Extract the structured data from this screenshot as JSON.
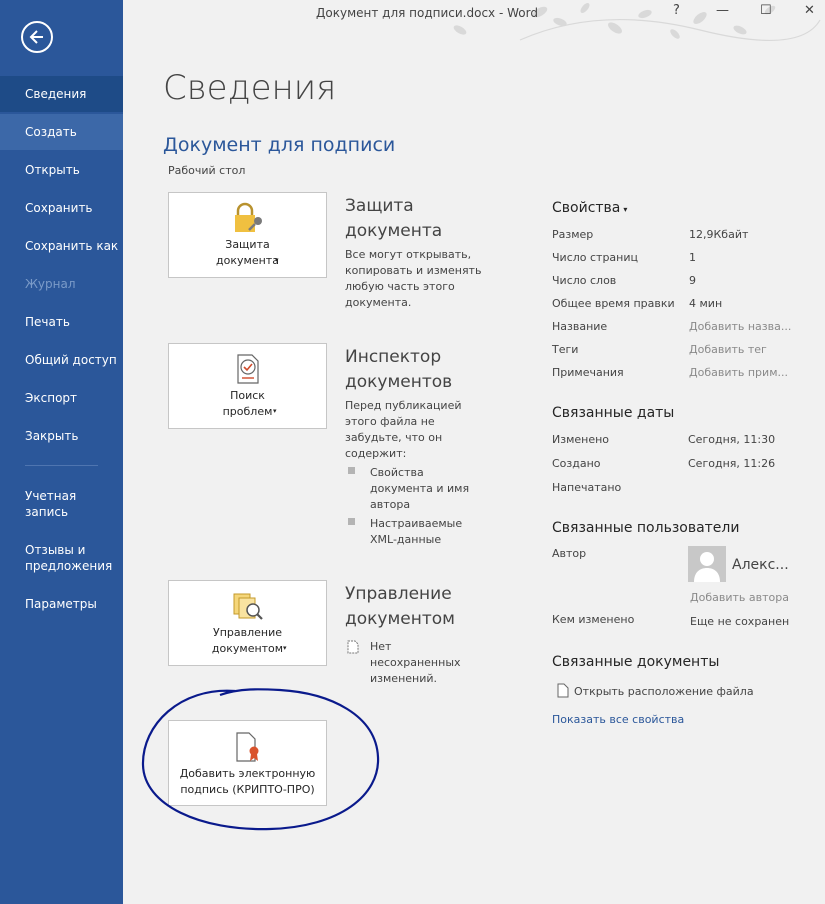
{
  "window": {
    "title": "Документ для подписи.docx  -  Word",
    "help": "?",
    "minimize": "—",
    "maximize": "☐",
    "close": "✕"
  },
  "sidebar": {
    "back_icon": "back-arrow-icon",
    "items": [
      {
        "label": "Сведения",
        "state": "active"
      },
      {
        "label": "Создать",
        "state": "hover"
      },
      {
        "label": "Открыть"
      },
      {
        "label": "Сохранить"
      },
      {
        "label": "Сохранить как"
      },
      {
        "label": "Журнал",
        "state": "disabled"
      },
      {
        "label": "Печать"
      },
      {
        "label": "Общий доступ"
      },
      {
        "label": "Экспорт"
      },
      {
        "label": "Закрыть"
      },
      {
        "label": "Учетная запись"
      },
      {
        "label": "Отзывы и предложения"
      },
      {
        "label": "Параметры"
      }
    ]
  },
  "main": {
    "page_title": "Сведения",
    "doc_title": "Документ для подписи",
    "doc_path": "Рабочий стол",
    "protect": {
      "button": "Защита документа",
      "heading": "Защита документа",
      "text": "Все могут открывать, копировать и изменять любую часть этого документа."
    },
    "inspect": {
      "button": "Поиск проблем",
      "heading": "Инспектор документов",
      "text": "Перед публикацией этого файла не забудьте, что он содержит:",
      "bullets": [
        "Свойства документа и имя автора",
        "Настраиваемые XML-данные"
      ]
    },
    "manage": {
      "button": "Управление документом",
      "heading": "Управление документом",
      "text": "Нет несохраненных изменений."
    },
    "signature_button": "Добавить электронную подпись (КРИПТО-ПРО)"
  },
  "properties": {
    "heading": "Свойства",
    "rows": [
      {
        "key": "Размер",
        "value": "12,9Кбайт"
      },
      {
        "key": "Число страниц",
        "value": "1"
      },
      {
        "key": "Число слов",
        "value": "9"
      },
      {
        "key": "Общее время правки",
        "value": "4 мин"
      },
      {
        "key": "Название",
        "value": "Добавить назва..."
      },
      {
        "key": "Теги",
        "value": "Добавить тег"
      },
      {
        "key": "Примечания",
        "value": "Добавить прим..."
      }
    ],
    "dates_heading": "Связанные даты",
    "dates": [
      {
        "key": "Изменено",
        "value": "Сегодня, 11:30"
      },
      {
        "key": "Создано",
        "value": "Сегодня, 11:26"
      },
      {
        "key": "Напечатано",
        "value": ""
      }
    ],
    "people_heading": "Связанные пользователи",
    "author_key": "Автор",
    "author_name": "Алекс...",
    "add_author": "Добавить автора",
    "modified_by_key": "Кем изменено",
    "modified_by_value": "Еще не сохранен",
    "docs_heading": "Связанные документы",
    "open_location": "Открыть расположение файла",
    "show_all": "Показать все свойства"
  },
  "colors": {
    "sidebar": "#2b579a",
    "accent": "#2b579a",
    "annotation": "#0a1a8c"
  }
}
